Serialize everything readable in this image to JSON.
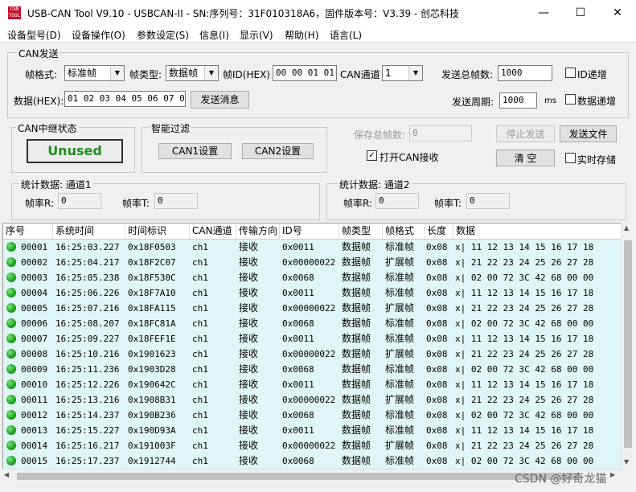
{
  "window": {
    "title": "USB-CAN Tool V9.10 - USBCAN-II - SN:序列号：31F010318A6，固件版本号：V3.39 - 创芯科技",
    "icon_text": "CAN TOOL",
    "minimize": "—",
    "maximize": "☐",
    "close": "✕"
  },
  "menu": [
    "设备型号(D)",
    "设备操作(O)",
    "参数设定(S)",
    "信息(I)",
    "显示(V)",
    "帮助(H)",
    "语言(L)"
  ],
  "can_send": {
    "title": "CAN发送",
    "frame_format_label": "帧格式:",
    "frame_format_value": "标准帧",
    "frame_type_label": "帧类型:",
    "frame_type_value": "数据帧",
    "frame_id_label": "帧ID(HEX)",
    "frame_id_value": "00 00 01 01",
    "channel_label": "CAN通道",
    "channel_value": "1",
    "total_frames_label": "发送总帧数:",
    "total_frames_value": "1000",
    "id_increment_label": "ID递增",
    "data_label": "数据(HEX):",
    "data_value": "01 02 03 04 05 06 07 08",
    "send_button": "发送消息",
    "period_label": "发送周期:",
    "period_value": "1000",
    "period_unit": "ms",
    "data_increment_label": "数据递增"
  },
  "relay": {
    "title": "CAN中继状态",
    "status": "Unused"
  },
  "filter": {
    "title": "智能过滤",
    "can1_button": "CAN1设置",
    "can2_button": "CAN2设置"
  },
  "right_panel": {
    "save_total_label": "保存总帧数:",
    "save_total_value": "0",
    "stop_send": "停止发送",
    "send_file": "发送文件",
    "open_can_recv": "打开CAN接收",
    "open_can_recv_checked": true,
    "clear": "清 空",
    "realtime_save": "实时存储"
  },
  "stats1": {
    "title": "统计数据: 通道1",
    "rate_r_label": "帧率R:",
    "rate_r_value": "0",
    "rate_t_label": "帧率T:",
    "rate_t_value": "0"
  },
  "stats2": {
    "title": "统计数据: 通道2",
    "rate_r_label": "帧率R:",
    "rate_r_value": "0",
    "rate_t_label": "帧率T:",
    "rate_t_value": "0"
  },
  "table": {
    "headers": [
      "序号",
      "系统时间",
      "时间标识",
      "CAN通道",
      "传输方向",
      "ID号",
      "帧类型",
      "帧格式",
      "长度",
      "数据"
    ],
    "rows": [
      [
        "00001",
        "16:25:03.227",
        "0x18F0503",
        "ch1",
        "接收",
        "0x0011",
        "数据帧",
        "标准帧",
        "0x08",
        "x| 11 12 13 14 15 16 17 18"
      ],
      [
        "00002",
        "16:25:04.217",
        "0x18F2C07",
        "ch1",
        "接收",
        "0x00000022",
        "数据帧",
        "扩展帧",
        "0x08",
        "x| 21 22 23 24 25 26 27 28"
      ],
      [
        "00003",
        "16:25:05.238",
        "0x18F530C",
        "ch1",
        "接收",
        "0x0068",
        "数据帧",
        "标准帧",
        "0x08",
        "x| 02 00 72 3C 42 68 00 00"
      ],
      [
        "00004",
        "16:25:06.226",
        "0x18F7A10",
        "ch1",
        "接收",
        "0x0011",
        "数据帧",
        "标准帧",
        "0x08",
        "x| 11 12 13 14 15 16 17 18"
      ],
      [
        "00005",
        "16:25:07.216",
        "0x18FA115",
        "ch1",
        "接收",
        "0x00000022",
        "数据帧",
        "扩展帧",
        "0x08",
        "x| 21 22 23 24 25 26 27 28"
      ],
      [
        "00006",
        "16:25:08.207",
        "0x18FC81A",
        "ch1",
        "接收",
        "0x0068",
        "数据帧",
        "标准帧",
        "0x08",
        "x| 02 00 72 3C 42 68 00 00"
      ],
      [
        "00007",
        "16:25:09.227",
        "0x18FEF1E",
        "ch1",
        "接收",
        "0x0011",
        "数据帧",
        "标准帧",
        "0x08",
        "x| 11 12 13 14 15 16 17 18"
      ],
      [
        "00008",
        "16:25:10.216",
        "0x1901623",
        "ch1",
        "接收",
        "0x00000022",
        "数据帧",
        "扩展帧",
        "0x08",
        "x| 21 22 23 24 25 26 27 28"
      ],
      [
        "00009",
        "16:25:11.236",
        "0x1903D28",
        "ch1",
        "接收",
        "0x0068",
        "数据帧",
        "标准帧",
        "0x08",
        "x| 02 00 72 3C 42 68 00 00"
      ],
      [
        "00010",
        "16:25:12.226",
        "0x190642C",
        "ch1",
        "接收",
        "0x0011",
        "数据帧",
        "标准帧",
        "0x08",
        "x| 11 12 13 14 15 16 17 18"
      ],
      [
        "00011",
        "16:25:13.216",
        "0x1908B31",
        "ch1",
        "接收",
        "0x00000022",
        "数据帧",
        "扩展帧",
        "0x08",
        "x| 21 22 23 24 25 26 27 28"
      ],
      [
        "00012",
        "16:25:14.237",
        "0x190B236",
        "ch1",
        "接收",
        "0x0068",
        "数据帧",
        "标准帧",
        "0x08",
        "x| 02 00 72 3C 42 68 00 00"
      ],
      [
        "00013",
        "16:25:15.227",
        "0x190D93A",
        "ch1",
        "接收",
        "0x0011",
        "数据帧",
        "标准帧",
        "0x08",
        "x| 11 12 13 14 15 16 17 18"
      ],
      [
        "00014",
        "16:25:16.217",
        "0x191003F",
        "ch1",
        "接收",
        "0x00000022",
        "数据帧",
        "扩展帧",
        "0x08",
        "x| 21 22 23 24 25 26 27 28"
      ],
      [
        "00015",
        "16:25:17.237",
        "0x1912744",
        "ch1",
        "接收",
        "0x0068",
        "数据帧",
        "标准帧",
        "0x08",
        "x| 02 00 72 3C 42 68 00 00"
      ]
    ]
  },
  "watermark": "CSDN @好奇龙猫",
  "colors": {
    "table_bg": "#e0f5f5",
    "status_dot": "#1aa11a",
    "unused_text": "#1e8f1e"
  }
}
